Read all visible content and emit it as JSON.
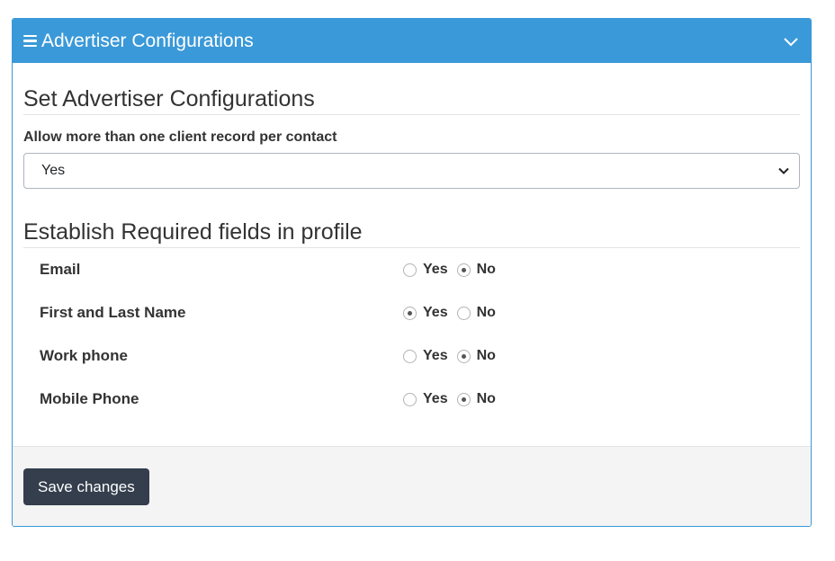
{
  "panel": {
    "title": "Advertiser Configurations",
    "menu_icon": "hamburger-icon",
    "collapse_icon": "chevron-down-icon",
    "accent_color": "#3a99d8"
  },
  "section1": {
    "title": "Set Advertiser Configurations",
    "field_label": "Allow more than one client record per contact",
    "select_value": "Yes"
  },
  "section2": {
    "title": "Establish Required fields in profile",
    "yes_label": "Yes",
    "no_label": "No",
    "rows": [
      {
        "label": "Email",
        "selected": "No"
      },
      {
        "label": "First and Last Name",
        "selected": "Yes"
      },
      {
        "label": "Work phone",
        "selected": "No"
      },
      {
        "label": "Mobile Phone",
        "selected": "No"
      }
    ]
  },
  "footer": {
    "save_label": "Save changes",
    "button_color": "#343e4c"
  }
}
